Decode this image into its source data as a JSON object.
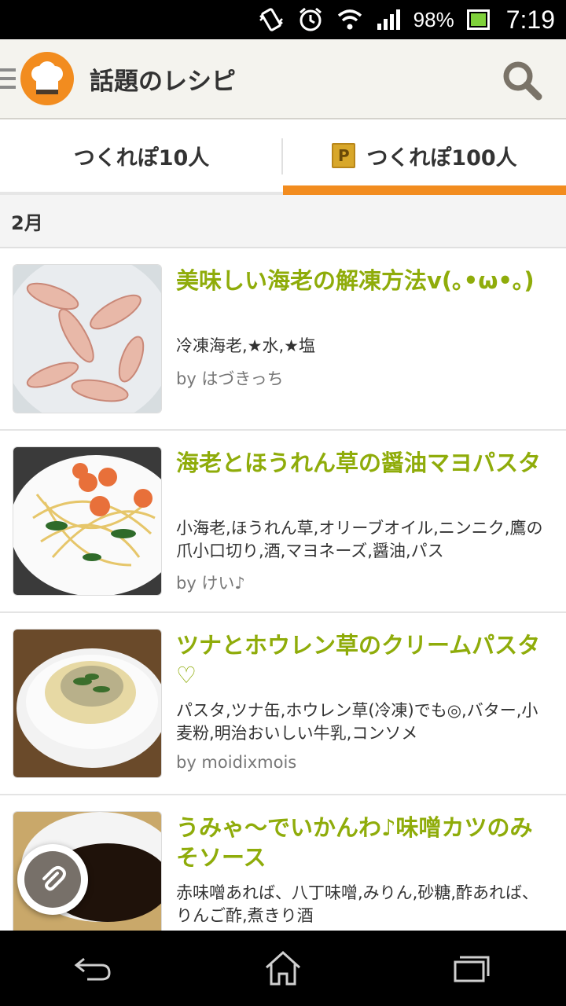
{
  "status_bar": {
    "battery_text": "98%",
    "time": "7:19",
    "icons": [
      "vibrate-icon",
      "alarm-icon",
      "wifi-icon",
      "signal-icon",
      "battery-icon"
    ]
  },
  "action_bar": {
    "title": "話題のレシピ",
    "logo_icon": "chef-hat-icon",
    "search_icon": "search-icon"
  },
  "tabs": [
    {
      "label": "つくれぽ10人",
      "selected": false
    },
    {
      "label": "つくれぽ100人",
      "badge": "P",
      "selected": true
    }
  ],
  "section": {
    "title": "2月"
  },
  "recipes": [
    {
      "title": "美味しい海老の解凍方法v(｡•ω•｡)",
      "ingredients": "冷凍海老,★水,★塩",
      "author": "by はづきっち"
    },
    {
      "title": "海老とほうれん草の醤油マヨパスタ",
      "ingredients": "小海老,ほうれん草,オリーブオイル,ニンニク,鷹の爪小口切り,酒,マヨネーズ,醤油,パス",
      "author": "by けい♪"
    },
    {
      "title": "ツナとホウレン草のクリームパスタ♡",
      "ingredients": "パスタ,ツナ缶,ホウレン草(冷凍)でも◎,バター,小麦粉,明治おいしい牛乳,コンソメ",
      "author": "by moidixmois"
    },
    {
      "title": "うみゃ～でいかんわ♪味噌カツのみそソース",
      "ingredients": "赤味噌あれば、八丁味噌,みりん,砂糖,酢あれば、りんご酢,煮きり酒",
      "author": ""
    }
  ],
  "colors": {
    "accent": "#f28c1f",
    "title_green": "#8fac0a"
  },
  "fab_icon": "paperclip-icon",
  "nav": [
    "back-icon",
    "home-icon",
    "recent-apps-icon"
  ]
}
